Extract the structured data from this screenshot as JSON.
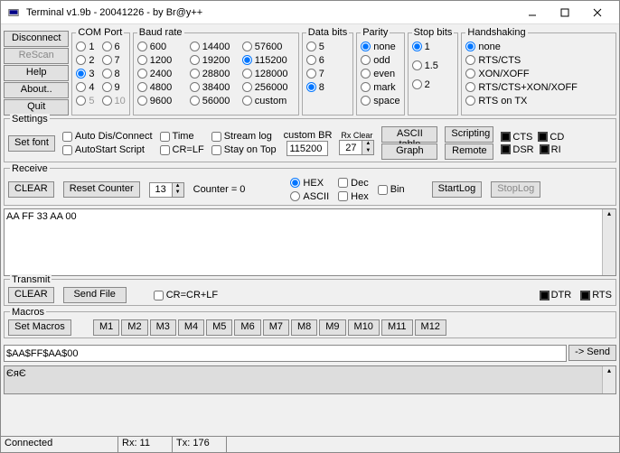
{
  "window": {
    "title": "Terminal v1.9b - 20041226 - by Br@y++"
  },
  "side": {
    "disconnect": "Disconnect",
    "rescan": "ReScan",
    "help": "Help",
    "about": "About..",
    "quit": "Quit"
  },
  "com": {
    "legend": "COM Port",
    "vals": [
      "1",
      "2",
      "3",
      "4",
      "5",
      "6",
      "7",
      "8",
      "9",
      "10"
    ],
    "sel": "3"
  },
  "baud": {
    "legend": "Baud rate",
    "c1": [
      "600",
      "1200",
      "2400",
      "4800",
      "9600"
    ],
    "c2": [
      "14400",
      "19200",
      "28800",
      "38400",
      "56000"
    ],
    "c3": [
      "57600",
      "115200",
      "128000",
      "256000",
      "custom"
    ],
    "sel": "115200"
  },
  "databits": {
    "legend": "Data bits",
    "vals": [
      "5",
      "6",
      "7",
      "8"
    ],
    "sel": "8"
  },
  "parity": {
    "legend": "Parity",
    "vals": [
      "none",
      "odd",
      "even",
      "mark",
      "space"
    ],
    "sel": "none"
  },
  "stopbits": {
    "legend": "Stop bits",
    "vals": [
      "1",
      "1.5",
      "2"
    ],
    "sel": "1"
  },
  "hand": {
    "legend": "Handshaking",
    "vals": [
      "none",
      "RTS/CTS",
      "XON/XOFF",
      "RTS/CTS+XON/XOFF",
      "RTS on TX"
    ],
    "sel": "none"
  },
  "settings": {
    "legend": "Settings",
    "setfont": "Set font",
    "autodis": "Auto Dis/Connect",
    "autostart": "AutoStart Script",
    "time": "Time",
    "crlf": "CR=LF",
    "stream": "Stream log",
    "stay": "Stay on Top",
    "custombr_lbl": "custom BR",
    "custombr_val": "115200",
    "rxclear_lbl": "Rx Clear",
    "rxclear_val": "27",
    "ascii": "ASCII table",
    "graph": "Graph",
    "scripting": "Scripting",
    "remote": "Remote",
    "cts": "CTS",
    "cd": "CD",
    "dsr": "DSR",
    "ri": "RI"
  },
  "recv": {
    "legend": "Receive",
    "clear": "CLEAR",
    "reset": "Reset Counter",
    "cnt_val": "13",
    "cnt_lbl": "Counter = ",
    "cnt": "0",
    "hex": "HEX",
    "ascii": "ASCII",
    "dec": "Dec",
    "hexlc": "Hex",
    "bin": "Bin",
    "start": "StartLog",
    "stop": "StopLog",
    "data": "AA FF 33 AA 00"
  },
  "tx": {
    "legend": "Transmit",
    "clear": "CLEAR",
    "send": "Send File",
    "cr": "CR=CR+LF",
    "dtr": "DTR",
    "rts": "RTS"
  },
  "macros": {
    "legend": "Macros",
    "set": "Set Macros",
    "m": [
      "M1",
      "M2",
      "M3",
      "M4",
      "M5",
      "M6",
      "M7",
      "M8",
      "M9",
      "M10",
      "M11",
      "M12"
    ]
  },
  "sendline": {
    "val": "$AA$FF$AA$00",
    "btn": "-> Send"
  },
  "out": {
    "data": "ЄяЄ"
  },
  "status": {
    "conn": "Connected",
    "rx": "Rx: 11",
    "tx": "Tx: 176"
  }
}
